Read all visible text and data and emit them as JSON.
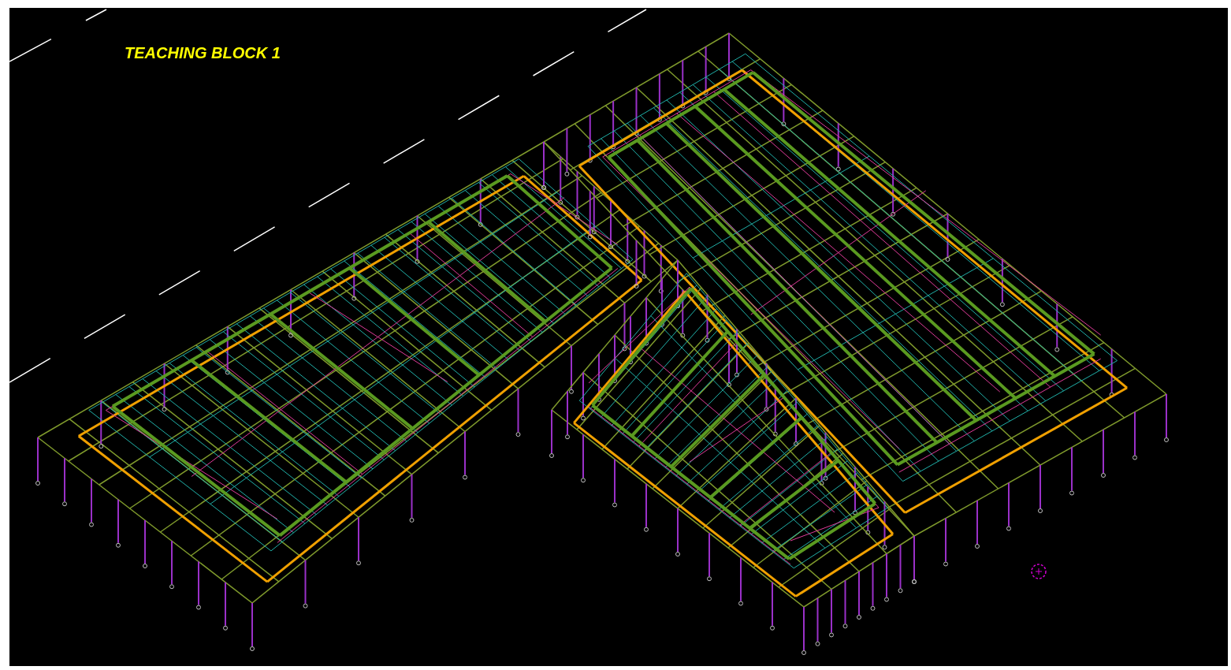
{
  "viewport": {
    "title": "TEACHING BLOCK 1"
  }
}
